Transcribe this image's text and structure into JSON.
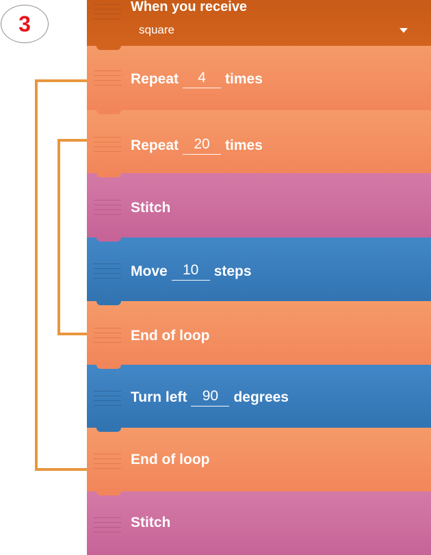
{
  "step_number": "3",
  "colors": {
    "event": "#cc5f1b",
    "control": "#f48f5f",
    "pen": "#cc6e9f",
    "motion": "#3a7ebd",
    "bracket": "#e8963e",
    "step_number": "#e8141c"
  },
  "bricks": [
    {
      "kind": "event",
      "label": "When you receive",
      "message": "square",
      "icon": "caret-down-icon"
    },
    {
      "kind": "control",
      "before": "Repeat",
      "value": "4",
      "after": "times"
    },
    {
      "kind": "control",
      "before": "Repeat",
      "value": "20",
      "after": "times"
    },
    {
      "kind": "pen",
      "label": "Stitch"
    },
    {
      "kind": "motion",
      "before": "Move",
      "value": "10",
      "after": "steps"
    },
    {
      "kind": "control",
      "label": "End of loop"
    },
    {
      "kind": "motion",
      "before": "Turn left",
      "value": "90",
      "after": "degrees"
    },
    {
      "kind": "control",
      "label": "End of loop"
    },
    {
      "kind": "pen",
      "label": "Stitch"
    }
  ]
}
